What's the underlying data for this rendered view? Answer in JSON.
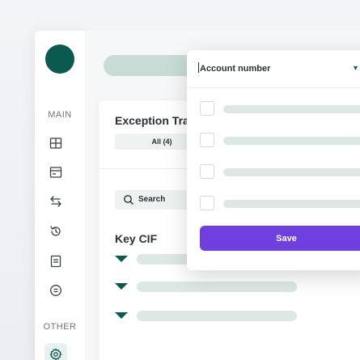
{
  "sidebar": {
    "main_label": "MAIN",
    "other_label": "OTHER",
    "items": [
      {
        "icon": "grid-icon"
      },
      {
        "icon": "card-icon"
      },
      {
        "icon": "transfer-arrows-icon"
      },
      {
        "icon": "history-icon"
      },
      {
        "icon": "document-icon"
      },
      {
        "icon": "currency-icon"
      }
    ],
    "settings_icon": "gear-icon",
    "accent_color": "#0b5a4f"
  },
  "main": {
    "card_title": "Exception Tra",
    "tab_all": "All (4)",
    "search_label": "Search",
    "section_title": "Key CIF"
  },
  "popover": {
    "header": "Account number",
    "options_count_visible": 4,
    "save_label": "Save",
    "button_color": "#6f3fe0"
  }
}
